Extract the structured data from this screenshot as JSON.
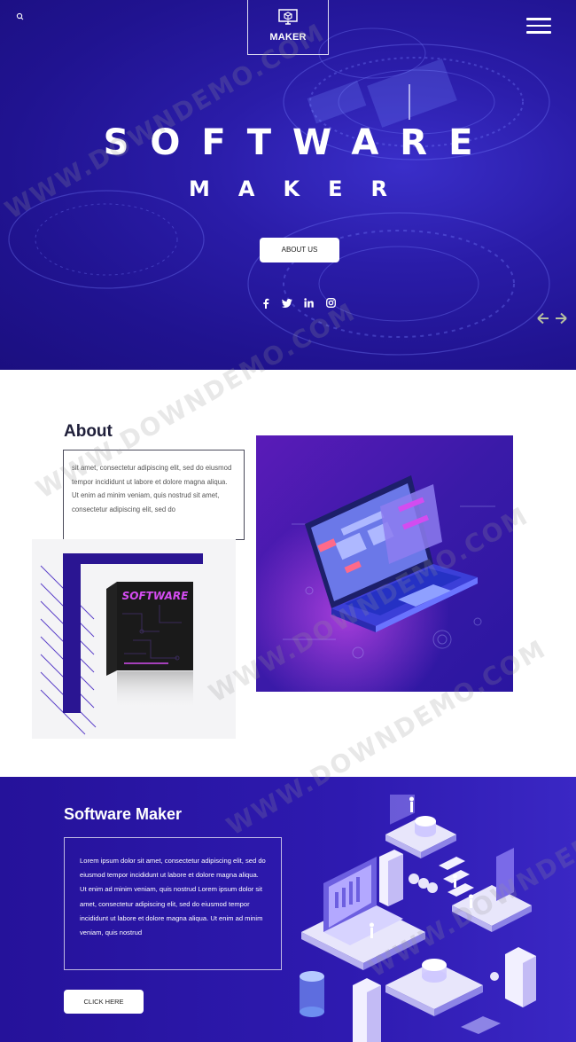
{
  "header": {
    "logo_text": "MAKER"
  },
  "hero": {
    "title": "SOFTWARE",
    "subtitle": "MAKER",
    "button_label": "ABOUT US",
    "social_icons": [
      "facebook-icon",
      "twitter-icon",
      "linkedin-icon",
      "instagram-icon"
    ],
    "social_glyphs": [
      "f",
      "t",
      "in",
      "ig"
    ]
  },
  "about": {
    "title": "About",
    "text": "sit amet, consectetur adipiscing elit, sed do eiusmod tempor incididunt ut labore et dolore magna aliqua. Ut enim ad minim veniam, quis nostrud sit amet, consectetur adipiscing elit, sed do",
    "product_label": "SOFTWARE"
  },
  "software_maker": {
    "title": "Software Maker",
    "text": "Lorem ipsum dolor sit amet, consectetur adipiscing elit, sed do eiusmod tempor incididunt ut labore et dolore magna aliqua. Ut enim ad minim veniam, quis nostrud Lorem ipsum dolor sit amet, consectetur adipiscing elit, sed do eiusmod tempor incididunt ut labore et dolore magna aliqua. Ut enim ad minim veniam, quis nostrud",
    "button_label": "CLICK HERE"
  },
  "watermark": "WWW.DOWNDEMO.COM",
  "colors": {
    "hero_bg": "#201390",
    "accent_purple": "#2a1592",
    "section_bg": "#2e1ab0",
    "product_pink": "#d34cf0"
  }
}
